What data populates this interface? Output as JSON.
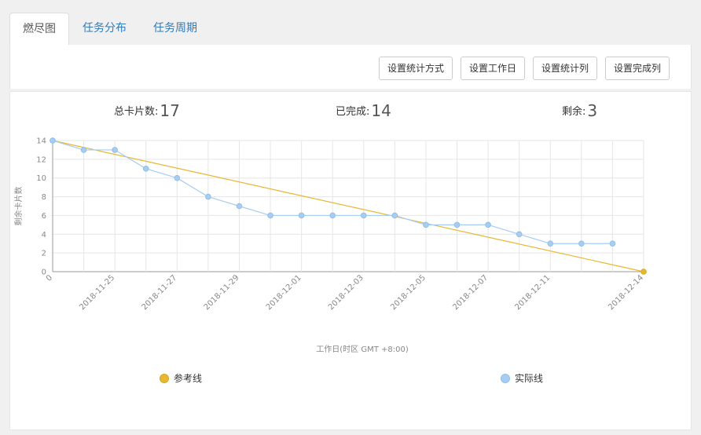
{
  "tabs": [
    {
      "label": "燃尽图",
      "active": true
    },
    {
      "label": "任务分布",
      "active": false
    },
    {
      "label": "任务周期",
      "active": false
    }
  ],
  "toolbar": {
    "buttons": [
      "设置统计方式",
      "设置工作日",
      "设置统计列",
      "设置完成列"
    ]
  },
  "stats": {
    "total_label": "总卡片数:",
    "total_value": "17",
    "done_label": "已完成:",
    "done_value": "14",
    "remain_label": "剩余:",
    "remain_value": "3"
  },
  "colors": {
    "reference": "#e8b730",
    "actual": "#a7cdf0",
    "actual_stroke": "#8ec0ea",
    "grid": "#e6e6e6"
  },
  "chart_data": {
    "type": "line",
    "xlabel": "工作日(时区 GMT +8:00)",
    "ylabel": "剩余卡片数",
    "ylim": [
      0,
      14
    ],
    "yticks": [
      0,
      2,
      4,
      6,
      8,
      10,
      12,
      14
    ],
    "x_range": [
      0,
      19
    ],
    "xticks": [
      {
        "x": 0,
        "label": "0"
      },
      {
        "x": 2,
        "label": "2018-11-25"
      },
      {
        "x": 4,
        "label": "2018-11-27"
      },
      {
        "x": 6,
        "label": "2018-11-29"
      },
      {
        "x": 8,
        "label": "2018-12-01"
      },
      {
        "x": 10,
        "label": "2018-12-03"
      },
      {
        "x": 12,
        "label": "2018-12-05"
      },
      {
        "x": 14,
        "label": "2018-12-07"
      },
      {
        "x": 16,
        "label": "2018-12-11"
      },
      {
        "x": 19,
        "label": "2018-12-14"
      }
    ],
    "grid": true,
    "legend_placement": "bottom",
    "series": [
      {
        "name": "参考线",
        "points": [
          [
            0,
            14
          ],
          [
            19,
            0
          ]
        ]
      },
      {
        "name": "实际线",
        "points": [
          [
            0,
            14
          ],
          [
            1,
            13
          ],
          [
            2,
            13
          ],
          [
            3,
            11
          ],
          [
            4,
            10
          ],
          [
            5,
            8
          ],
          [
            6,
            7
          ],
          [
            7,
            6
          ],
          [
            8,
            6
          ],
          [
            9,
            6
          ],
          [
            10,
            6
          ],
          [
            11,
            6
          ],
          [
            12,
            5
          ],
          [
            13,
            5
          ],
          [
            14,
            5
          ],
          [
            15,
            4
          ],
          [
            16,
            3
          ],
          [
            17,
            3
          ],
          [
            18,
            3
          ]
        ]
      }
    ]
  }
}
